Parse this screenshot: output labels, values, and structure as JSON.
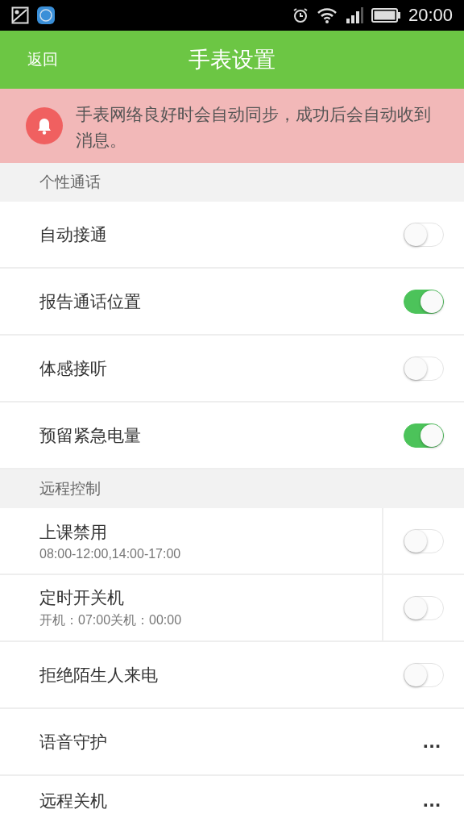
{
  "status_bar": {
    "time": "20:00"
  },
  "header": {
    "back": "返回",
    "title": "手表设置"
  },
  "notice": {
    "text": "手表网络良好时会自动同步，成功后会自动收到消息。"
  },
  "sections": [
    {
      "title": "个性通话",
      "rows": [
        {
          "kind": "toggle",
          "label": "自动接通",
          "on": false
        },
        {
          "kind": "toggle",
          "label": "报告通话位置",
          "on": true
        },
        {
          "kind": "toggle",
          "label": "体感接听",
          "on": false
        },
        {
          "kind": "toggle",
          "label": "预留紧急电量",
          "on": true
        }
      ]
    },
    {
      "title": "远程控制",
      "rows": [
        {
          "kind": "toggle",
          "label": "上课禁用",
          "subtitle": "08:00-12:00,14:00-17:00",
          "on": false
        },
        {
          "kind": "toggle",
          "label": "定时开关机",
          "subtitle": "开机：07:00关机：00:00",
          "on": false
        },
        {
          "kind": "toggle",
          "label": "拒绝陌生人来电",
          "on": false
        },
        {
          "kind": "more",
          "label": "语音守护",
          "more": "..."
        },
        {
          "kind": "more",
          "label": "远程关机",
          "more": "..."
        }
      ]
    }
  ]
}
